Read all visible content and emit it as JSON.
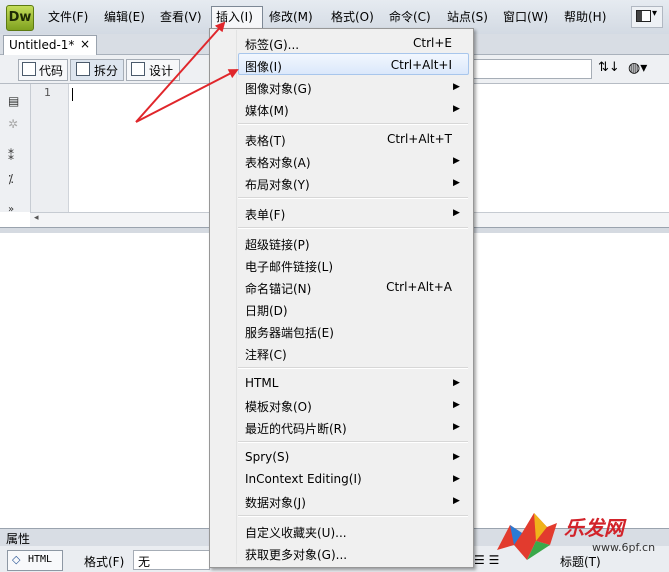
{
  "app": {
    "logo_text": "Dw"
  },
  "menubar": {
    "items": [
      "文件(F)",
      "编辑(E)",
      "查看(V)",
      "插入(I)",
      "修改(M)",
      "格式(O)",
      "命令(C)",
      "站点(S)",
      "窗口(W)",
      "帮助(H)"
    ],
    "active": "插入(I)",
    "layout_icon": "layout-grid-icon",
    "chevron": "▾"
  },
  "tabs": {
    "document": "Untitled-1*",
    "close_glyph": "×"
  },
  "doc_toolbar": {
    "views": [
      {
        "label": "代码",
        "icon": "code-view-icon"
      },
      {
        "label": "拆分",
        "icon": "split-view-icon"
      },
      {
        "label": "设计",
        "icon": "design-view-icon"
      }
    ],
    "title_value": "",
    "refresh_glyph": "⇅↓",
    "globe_glyph": "◍▾"
  },
  "code_view": {
    "line_numbers": [
      "1"
    ],
    "scroll_left_glyph": "◂"
  },
  "properties": {
    "title": "属性",
    "html_button": "HTML",
    "html_icon_glyph": "◇",
    "format_label": "格式(F)",
    "format_value": "无",
    "list_icons_glyph": "☰ ☰",
    "title_label": "标题(T)"
  },
  "insert_menu": {
    "groups": [
      [
        {
          "label": "标签(G)...",
          "shortcut": "Ctrl+E",
          "submenu": false
        },
        {
          "label": "图像(I)",
          "shortcut": "Ctrl+Alt+I",
          "submenu": false,
          "highlighted": true
        },
        {
          "label": "图像对象(G)",
          "shortcut": "",
          "submenu": true
        },
        {
          "label": "媒体(M)",
          "shortcut": "",
          "submenu": true
        }
      ],
      [
        {
          "label": "表格(T)",
          "shortcut": "Ctrl+Alt+T",
          "submenu": false
        },
        {
          "label": "表格对象(A)",
          "shortcut": "",
          "submenu": true
        },
        {
          "label": "布局对象(Y)",
          "shortcut": "",
          "submenu": true
        }
      ],
      [
        {
          "label": "表单(F)",
          "shortcut": "",
          "submenu": true
        }
      ],
      [
        {
          "label": "超级链接(P)",
          "shortcut": "",
          "submenu": false
        },
        {
          "label": "电子邮件链接(L)",
          "shortcut": "",
          "submenu": false
        },
        {
          "label": "命名锚记(N)",
          "shortcut": "Ctrl+Alt+A",
          "submenu": false
        },
        {
          "label": "日期(D)",
          "shortcut": "",
          "submenu": false
        },
        {
          "label": "服务器端包括(E)",
          "shortcut": "",
          "submenu": false
        },
        {
          "label": "注释(C)",
          "shortcut": "",
          "submenu": false
        }
      ],
      [
        {
          "label": "HTML",
          "shortcut": "",
          "submenu": true
        },
        {
          "label": "模板对象(O)",
          "shortcut": "",
          "submenu": true
        },
        {
          "label": "最近的代码片断(R)",
          "shortcut": "",
          "submenu": true
        }
      ],
      [
        {
          "label": "Spry(S)",
          "shortcut": "",
          "submenu": true
        },
        {
          "label": "InContext Editing(I)",
          "shortcut": "",
          "submenu": true
        },
        {
          "label": "数据对象(J)",
          "shortcut": "",
          "submenu": true
        }
      ],
      [
        {
          "label": "自定义收藏夹(U)...",
          "shortcut": "",
          "submenu": false
        },
        {
          "label": "获取更多对象(G)...",
          "shortcut": "",
          "submenu": false
        }
      ]
    ],
    "arrow_glyph": "▶"
  },
  "watermark": {
    "text": "乐发网",
    "url": "www.6pf.cn"
  },
  "colors": {
    "accent_red": "#e0262b",
    "highlight": "#dbe8fb"
  }
}
